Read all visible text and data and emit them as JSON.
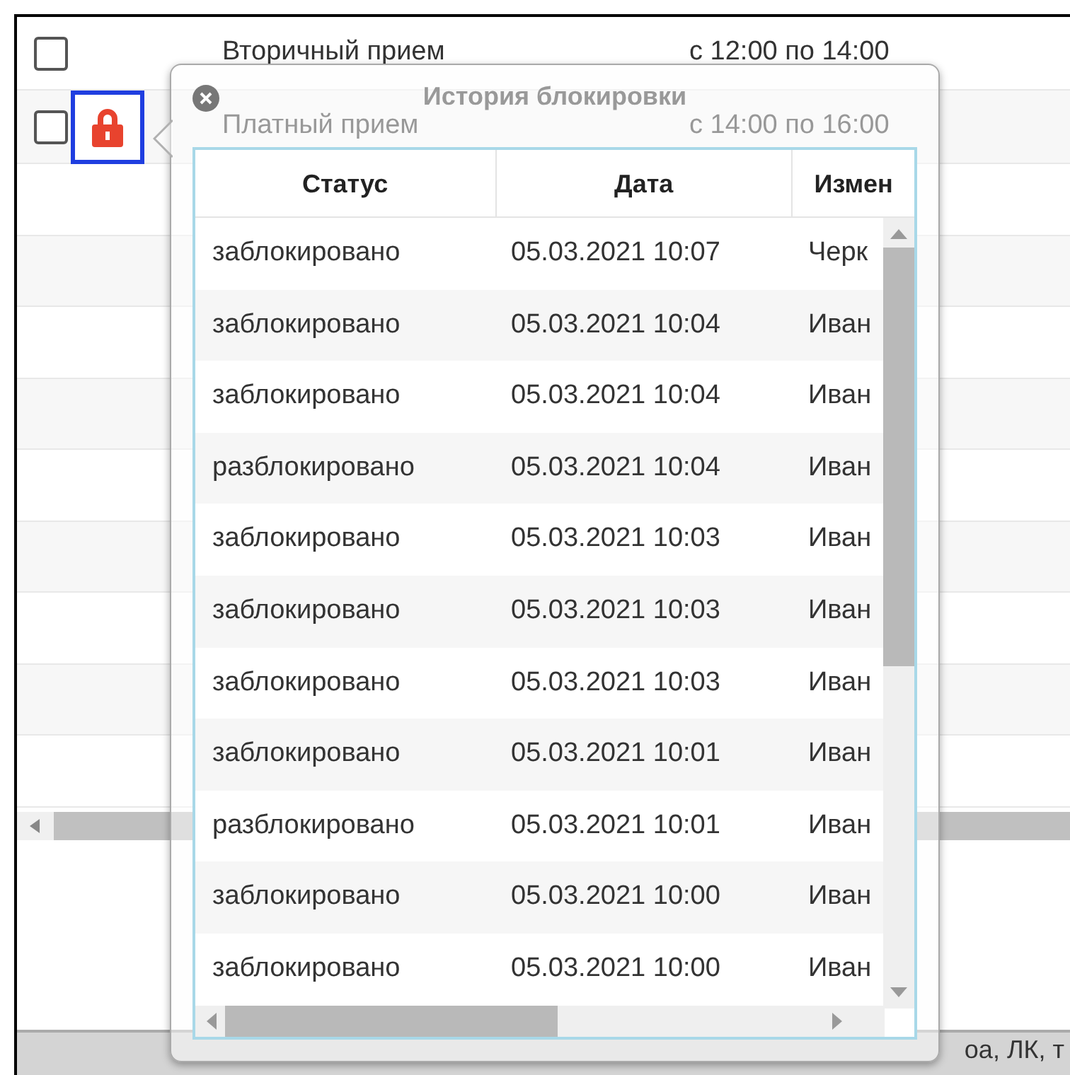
{
  "schedule_rows": [
    {
      "checked": false,
      "locked": false,
      "name": "Вторичный прием",
      "time": "с 12:00 по 14:00"
    },
    {
      "checked": false,
      "locked": true,
      "name": "Платный прием",
      "time": "с 14:00 по 16:00"
    }
  ],
  "footer": {
    "text": "оа, ЛК, т"
  },
  "popover": {
    "title": "История блокировки",
    "columns": [
      "Статус",
      "Дата",
      "Измен"
    ],
    "rows": [
      [
        "заблокировано",
        "05.03.2021 10:07",
        "Черк"
      ],
      [
        "заблокировано",
        "05.03.2021 10:04",
        "Иван"
      ],
      [
        "заблокировано",
        "05.03.2021 10:04",
        "Иван"
      ],
      [
        "разблокировано",
        "05.03.2021 10:04",
        "Иван"
      ],
      [
        "заблокировано",
        "05.03.2021 10:03",
        "Иван"
      ],
      [
        "заблокировано",
        "05.03.2021 10:03",
        "Иван"
      ],
      [
        "заблокировано",
        "05.03.2021 10:03",
        "Иван"
      ],
      [
        "заблокировано",
        "05.03.2021 10:01",
        "Иван"
      ],
      [
        "разблокировано",
        "05.03.2021 10:01",
        "Иван"
      ],
      [
        "заблокировано",
        "05.03.2021 10:00",
        "Иван"
      ],
      [
        "заблокировано",
        "05.03.2021 10:00",
        "Иван"
      ]
    ]
  }
}
